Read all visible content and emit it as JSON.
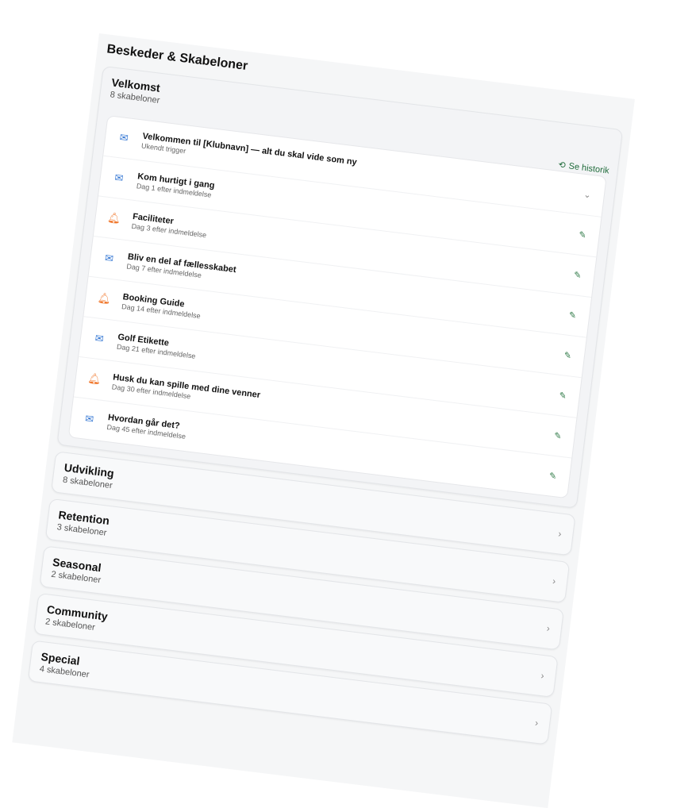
{
  "page": {
    "title": "Beskeder & Skabeloner"
  },
  "open_category": {
    "title": "Velkomst",
    "count": "8 skabeloner",
    "history_label": "Se historik",
    "templates": [
      {
        "icon": "mail-icon",
        "title": "Velkommen til [Klubnavn] — alt du skal vide som ny",
        "trigger": "Ukendt trigger",
        "action": "chevron-down"
      },
      {
        "icon": "mail-icon",
        "title": "Kom hurtigt i gang",
        "trigger": "Dag 1 efter indmeldelse",
        "action": "edit"
      },
      {
        "icon": "bell-icon",
        "title": "Faciliteter",
        "trigger": "Dag 3 efter indmeldelse",
        "action": "edit"
      },
      {
        "icon": "mail-icon",
        "title": "Bliv en del af fællesskabet",
        "trigger": "Dag 7 efter indmeldelse",
        "action": "edit"
      },
      {
        "icon": "bell-icon",
        "title": "Booking Guide",
        "trigger": "Dag 14 efter indmeldelse",
        "action": "edit"
      },
      {
        "icon": "mail-icon",
        "title": "Golf Etikette",
        "trigger": "Dag 21 efter indmeldelse",
        "action": "edit"
      },
      {
        "icon": "bell-icon",
        "title": "Husk du kan spille med dine venner",
        "trigger": "Dag 30 efter indmeldelse",
        "action": "edit"
      },
      {
        "icon": "mail-icon",
        "title": "Hvordan går det?",
        "trigger": "Dag 45 efter indmeldelse",
        "action": "edit"
      }
    ]
  },
  "categories": [
    {
      "title": "Udvikling",
      "count": "8 skabeloner"
    },
    {
      "title": "Retention",
      "count": "3 skabeloner"
    },
    {
      "title": "Seasonal",
      "count": "2 skabeloner"
    },
    {
      "title": "Community",
      "count": "2 skabeloner"
    },
    {
      "title": "Special",
      "count": "4 skabeloner"
    }
  ],
  "colors": {
    "mail": "#3a7bd5",
    "bell": "#f0782d",
    "edit": "#2f7a47"
  }
}
